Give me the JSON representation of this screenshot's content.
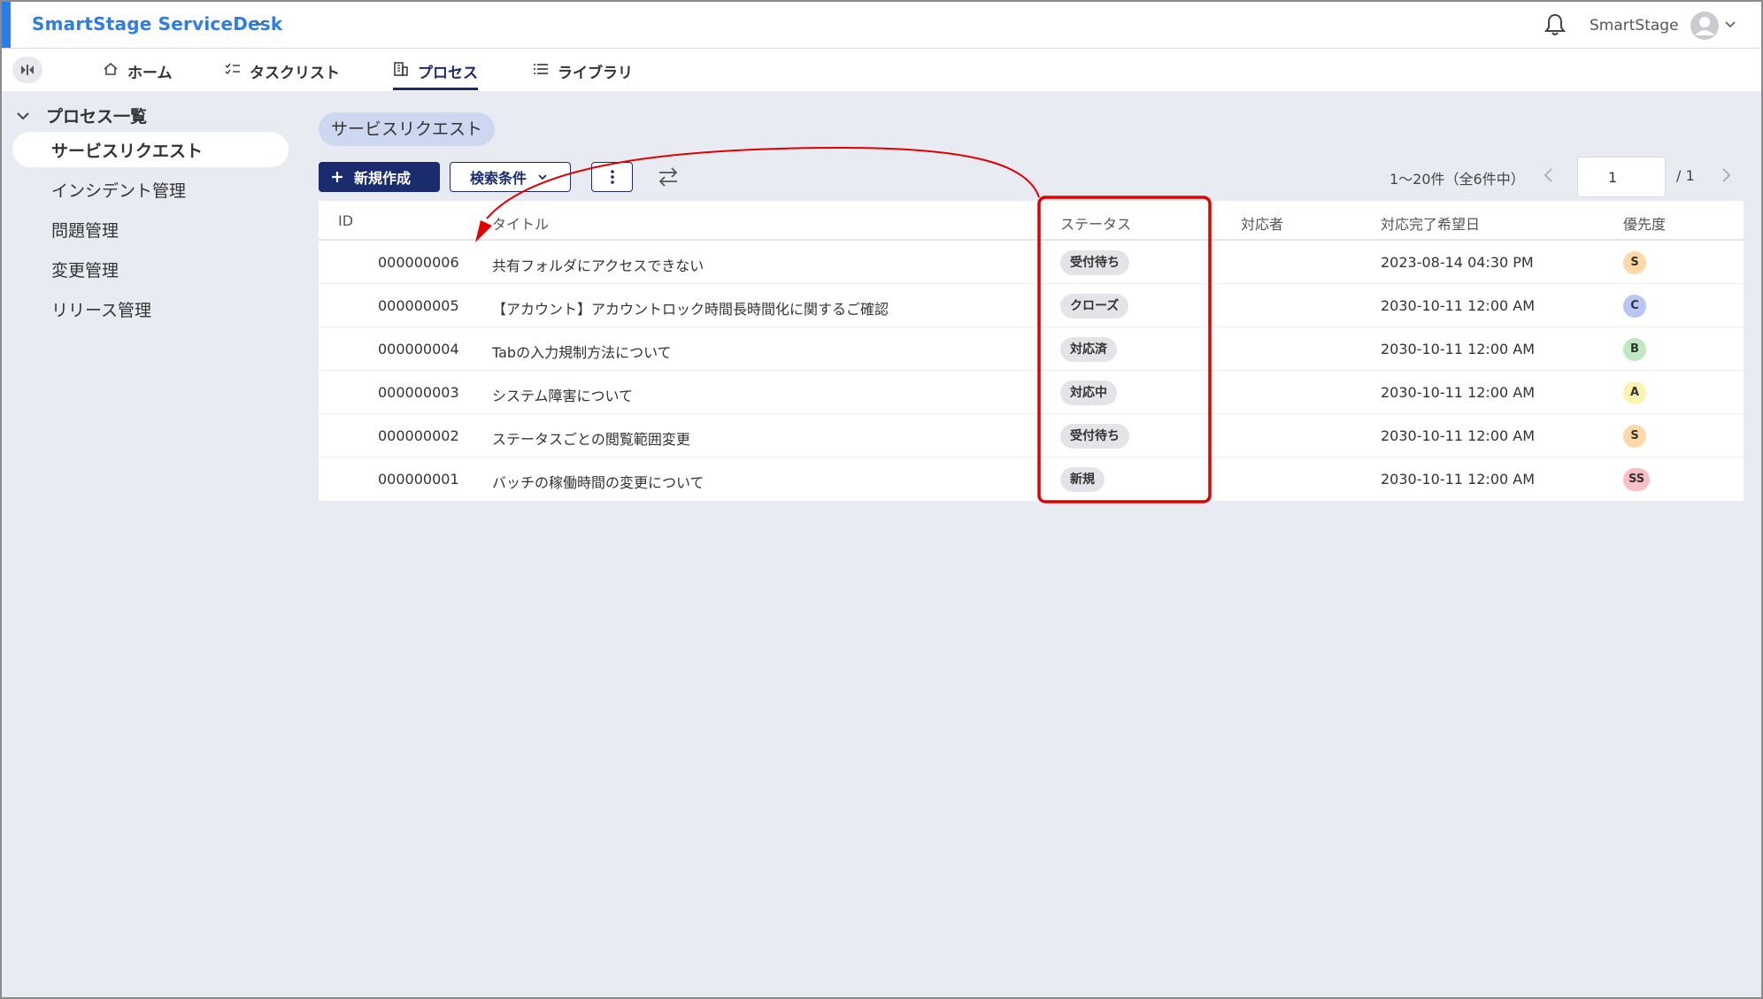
{
  "header": {
    "app_title": "SmartStage ServiceDesk",
    "user_name": "SmartStage"
  },
  "tabs": [
    {
      "label": "ホーム",
      "icon": "home-icon"
    },
    {
      "label": "タスクリスト",
      "icon": "checklist-icon"
    },
    {
      "label": "プロセス",
      "icon": "building-icon",
      "active": true
    },
    {
      "label": "ライブラリ",
      "icon": "list-icon"
    }
  ],
  "sidebar": {
    "group_label": "プロセス一覧",
    "items": [
      {
        "label": "サービスリクエスト",
        "active": true
      },
      {
        "label": "インシデント管理"
      },
      {
        "label": "問題管理"
      },
      {
        "label": "変更管理"
      },
      {
        "label": "リリース管理"
      }
    ]
  },
  "main": {
    "chip_label": "サービスリクエスト",
    "new_button_label": "新規作成",
    "search_button_label": "検索条件",
    "pager": {
      "range_text": "1～20件（全6件中）",
      "current_page": "1",
      "total_text": "/ 1"
    },
    "columns": {
      "id": "ID",
      "title": "タイトル",
      "status": "ステータス",
      "assignee": "対応者",
      "due": "対応完了希望日",
      "priority": "優先度"
    },
    "rows": [
      {
        "id": "000000006",
        "title": "共有フォルダにアクセスできない",
        "status": "受付待ち",
        "assignee": "",
        "due": "2023-08-14 04:30 PM",
        "priority": "S",
        "priority_color": "#fcd9a6"
      },
      {
        "id": "000000005",
        "title": "【アカウント】アカウントロック時間長時間化に関するご確認",
        "status": "クローズ",
        "assignee": "",
        "due": "2030-10-11 12:00 AM",
        "priority": "C",
        "priority_color": "#b8c5f5"
      },
      {
        "id": "000000004",
        "title": "Tabの入力規制方法について",
        "status": "対応済",
        "assignee": "",
        "due": "2030-10-11 12:00 AM",
        "priority": "B",
        "priority_color": "#bfe8c2"
      },
      {
        "id": "000000003",
        "title": "システム障害について",
        "status": "対応中",
        "assignee": "",
        "due": "2030-10-11 12:00 AM",
        "priority": "A",
        "priority_color": "#fbf3b0"
      },
      {
        "id": "000000002",
        "title": "ステータスごとの閲覧範囲変更",
        "status": "受付待ち",
        "assignee": "",
        "due": "2030-10-11 12:00 AM",
        "priority": "S",
        "priority_color": "#fcd9a6"
      },
      {
        "id": "000000001",
        "title": "バッチの稼働時間の変更について",
        "status": "新規",
        "assignee": "",
        "due": "2030-10-11 12:00 AM",
        "priority": "SS",
        "priority_color": "#f8c0c4"
      }
    ]
  },
  "colors": {
    "brand": "#2b7de9",
    "primary": "#1a2c6e",
    "annotation": "#e00000",
    "background": "#e8ebf2"
  }
}
